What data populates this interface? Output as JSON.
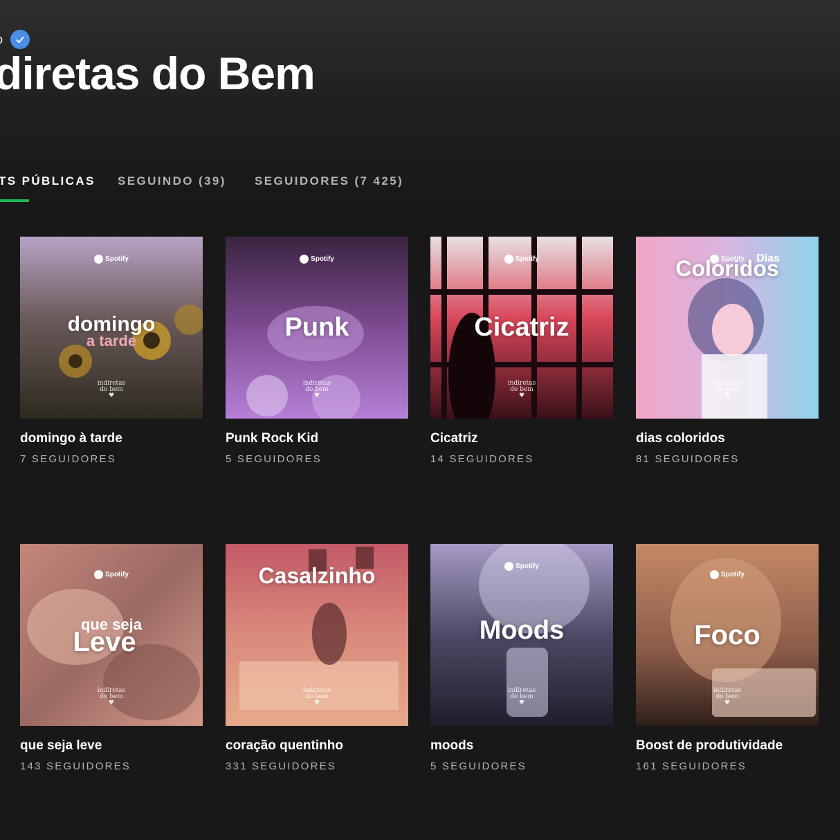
{
  "profile": {
    "verified_label": "o",
    "title": "diretas do Bem"
  },
  "tabs": [
    {
      "label": "TS PÚBLICAS",
      "active": true
    },
    {
      "label": "SEGUINDO (39)",
      "active": false
    },
    {
      "label": "SEGUIDORES (7 425)",
      "active": false
    }
  ],
  "cover_brand": "Spotify",
  "cover_logo": [
    "indiretas",
    "do bem"
  ],
  "playlists": [
    {
      "name": "domingo à tarde",
      "followers": "7 SEGUIDORES",
      "cover_title": "domingo",
      "cover_subtitle": "a tarde",
      "colors": [
        "#b8a3c6",
        "#6b5a5a",
        "#2d2a1f"
      ]
    },
    {
      "name": "Punk Rock Kid",
      "followers": "5 SEGUIDORES",
      "cover_title": "Punk",
      "cover_subtitle": "",
      "colors": [
        "#3a2440",
        "#7d4b91",
        "#b580d6"
      ]
    },
    {
      "name": "Cicatriz",
      "followers": "14 SEGUIDORES",
      "cover_title": "Cicatriz",
      "cover_subtitle": "",
      "colors": [
        "#e8e0e0",
        "#d9465a",
        "#3a1018"
      ]
    },
    {
      "name": "dias coloridos",
      "followers": "81 SEGUIDORES",
      "cover_title": "Coloridos",
      "cover_subtitle": "Dias",
      "colors": [
        "#f2a6c8",
        "#d7b5e0",
        "#8fd3ec"
      ]
    },
    {
      "name": "que seja leve",
      "followers": "143 SEGUIDORES",
      "cover_title": "Leve",
      "cover_subtitle": "que seja",
      "colors": [
        "#c4877a",
        "#9c6a63",
        "#d79b8a"
      ]
    },
    {
      "name": "coração quentinho",
      "followers": "331 SEGUIDORES",
      "cover_title": "Casalzinho",
      "cover_subtitle": "",
      "colors": [
        "#c45a67",
        "#d98a7c",
        "#e7a98a"
      ]
    },
    {
      "name": "moods",
      "followers": "5 SEGUIDORES",
      "cover_title": "Moods",
      "cover_subtitle": "",
      "colors": [
        "#a69ac4",
        "#4e4a66",
        "#1f1d2a"
      ]
    },
    {
      "name": "Boost de produtividade",
      "followers": "161 SEGUIDORES",
      "cover_title": "Foco",
      "cover_subtitle": "",
      "colors": [
        "#c48a66",
        "#8a5a48",
        "#2e1f1a"
      ]
    }
  ]
}
